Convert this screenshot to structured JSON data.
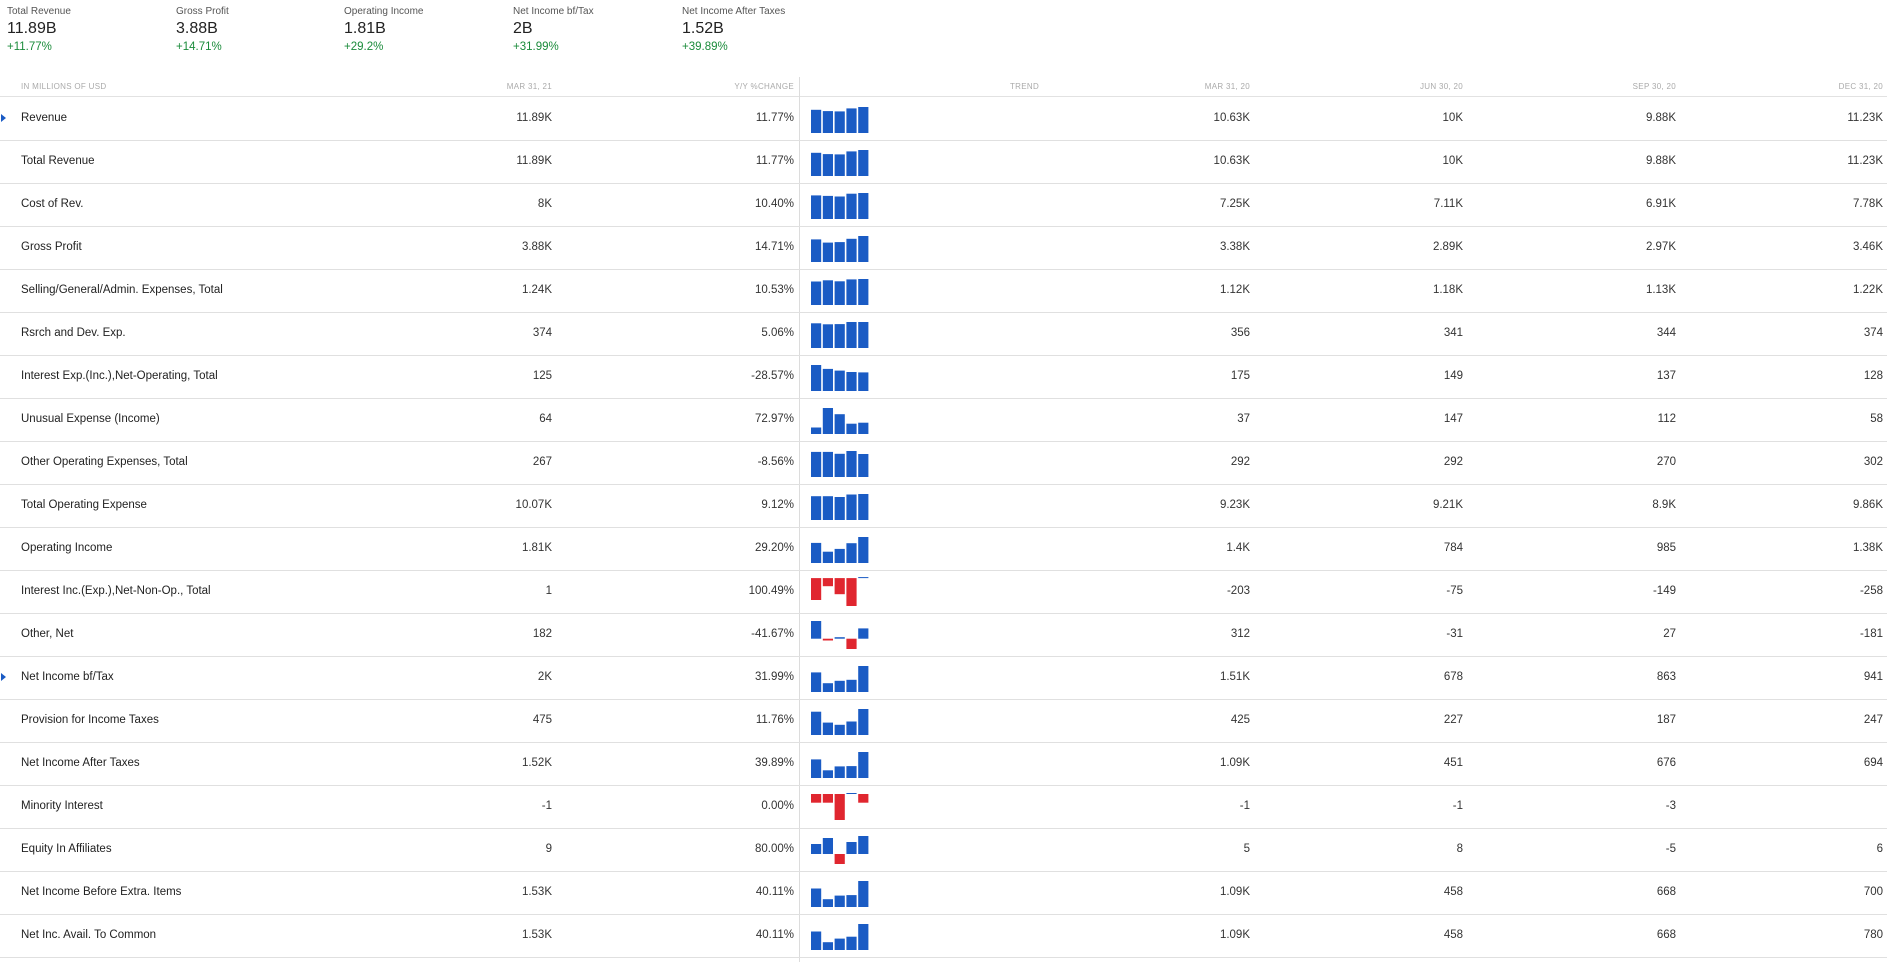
{
  "kpis": [
    {
      "label": "Total Revenue",
      "value": "11.89B",
      "change": "+11.77%"
    },
    {
      "label": "Gross Profit",
      "value": "3.88B",
      "change": "+14.71%"
    },
    {
      "label": "Operating Income",
      "value": "1.81B",
      "change": "+29.2%"
    },
    {
      "label": "Net Income bf/Tax",
      "value": "2B",
      "change": "+31.99%"
    },
    {
      "label": "Net Income After Taxes",
      "value": "1.52B",
      "change": "+39.89%"
    }
  ],
  "table": {
    "headers": {
      "units": "IN MILLIONS OF USD",
      "current": "MAR 31, 21",
      "yoy": "Y/Y %CHANGE",
      "trend": "TREND",
      "q1": "MAR 31, 20",
      "q2": "JUN 30, 20",
      "q3": "SEP 30, 20",
      "q4": "DEC 31, 20"
    },
    "colors": {
      "positive": "#1a8b3a",
      "negative": "#d2232a",
      "bar_up": "#1a5bc4",
      "bar_down": "#e0262f"
    },
    "rows": [
      {
        "name": "Revenue",
        "expandable": true,
        "current": "11.89K",
        "yoy": "11.77%",
        "yoy_sign": "pos",
        "q1": "10.63K",
        "q2": "10K",
        "q3": "9.88K",
        "q4": "11.23K",
        "trend": [
          10630,
          10000,
          9880,
          11230,
          11890
        ]
      },
      {
        "name": "Total Revenue",
        "expandable": false,
        "current": "11.89K",
        "yoy": "11.77%",
        "yoy_sign": "pos",
        "q1": "10.63K",
        "q2": "10K",
        "q3": "9.88K",
        "q4": "11.23K",
        "trend": [
          10630,
          10000,
          9880,
          11230,
          11890
        ]
      },
      {
        "name": "Cost of Rev.",
        "expandable": false,
        "current": "8K",
        "yoy": "10.40%",
        "yoy_sign": "pos",
        "q1": "7.25K",
        "q2": "7.11K",
        "q3": "6.91K",
        "q4": "7.78K",
        "trend": [
          7250,
          7110,
          6910,
          7780,
          8000
        ]
      },
      {
        "name": "Gross Profit",
        "expandable": false,
        "current": "3.88K",
        "yoy": "14.71%",
        "yoy_sign": "pos",
        "q1": "3.38K",
        "q2": "2.89K",
        "q3": "2.97K",
        "q4": "3.46K",
        "trend": [
          3380,
          2890,
          2970,
          3460,
          3880
        ]
      },
      {
        "name": "Selling/General/Admin. Expenses, Total",
        "expandable": false,
        "current": "1.24K",
        "yoy": "10.53%",
        "yoy_sign": "pos",
        "q1": "1.12K",
        "q2": "1.18K",
        "q3": "1.13K",
        "q4": "1.22K",
        "trend": [
          1120,
          1180,
          1130,
          1220,
          1240
        ]
      },
      {
        "name": "Rsrch and Dev. Exp.",
        "expandable": false,
        "current": "374",
        "yoy": "5.06%",
        "yoy_sign": "pos",
        "q1": "356",
        "q2": "341",
        "q3": "344",
        "q4": "374",
        "trend": [
          356,
          341,
          344,
          374,
          374
        ]
      },
      {
        "name": "Interest Exp.(Inc.),Net-Operating, Total",
        "expandable": false,
        "current": "125",
        "yoy": "-28.57%",
        "yoy_sign": "neg",
        "q1": "175",
        "q2": "149",
        "q3": "137",
        "q4": "128",
        "trend": [
          175,
          149,
          137,
          128,
          125
        ]
      },
      {
        "name": "Unusual Expense (Income)",
        "expandable": false,
        "current": "64",
        "yoy": "72.97%",
        "yoy_sign": "pos",
        "q1": "37",
        "q2": "147",
        "q3": "112",
        "q4": "58",
        "trend": [
          37,
          147,
          112,
          58,
          64
        ]
      },
      {
        "name": "Other Operating Expenses, Total",
        "expandable": false,
        "current": "267",
        "yoy": "-8.56%",
        "yoy_sign": "neg",
        "q1": "292",
        "q2": "292",
        "q3": "270",
        "q4": "302",
        "trend": [
          292,
          292,
          270,
          302,
          267
        ]
      },
      {
        "name": "Total Operating Expense",
        "expandable": false,
        "current": "10.07K",
        "yoy": "9.12%",
        "yoy_sign": "pos",
        "q1": "9.23K",
        "q2": "9.21K",
        "q3": "8.9K",
        "q4": "9.86K",
        "trend": [
          9230,
          9210,
          8900,
          9860,
          10070
        ]
      },
      {
        "name": "Operating Income",
        "expandable": false,
        "current": "1.81K",
        "yoy": "29.20%",
        "yoy_sign": "pos",
        "q1": "1.4K",
        "q2": "784",
        "q3": "985",
        "q4": "1.38K",
        "trend": [
          1400,
          784,
          985,
          1380,
          1810
        ]
      },
      {
        "name": "Interest Inc.(Exp.),Net-Non-Op., Total",
        "expandable": false,
        "current": "1",
        "yoy": "100.49%",
        "yoy_sign": "pos",
        "q1": "-203",
        "q2": "-75",
        "q3": "-149",
        "q4": "-258",
        "trend": [
          -203,
          -75,
          -149,
          -258,
          1
        ]
      },
      {
        "name": "Other, Net",
        "expandable": false,
        "current": "182",
        "yoy": "-41.67%",
        "yoy_sign": "neg",
        "q1": "312",
        "q2": "-31",
        "q3": "27",
        "q4": "-181",
        "trend": [
          312,
          -31,
          27,
          -181,
          182
        ]
      },
      {
        "name": "Net Income bf/Tax",
        "expandable": true,
        "current": "2K",
        "yoy": "31.99%",
        "yoy_sign": "pos",
        "q1": "1.51K",
        "q2": "678",
        "q3": "863",
        "q4": "941",
        "trend": [
          1510,
          678,
          863,
          941,
          2000
        ]
      },
      {
        "name": "Provision for Income Taxes",
        "expandable": false,
        "current": "475",
        "yoy": "11.76%",
        "yoy_sign": "pos",
        "q1": "425",
        "q2": "227",
        "q3": "187",
        "q4": "247",
        "trend": [
          425,
          227,
          187,
          247,
          475
        ]
      },
      {
        "name": "Net Income After Taxes",
        "expandable": false,
        "current": "1.52K",
        "yoy": "39.89%",
        "yoy_sign": "pos",
        "q1": "1.09K",
        "q2": "451",
        "q3": "676",
        "q4": "694",
        "trend": [
          1090,
          451,
          676,
          694,
          1520
        ]
      },
      {
        "name": "Minority Interest",
        "expandable": false,
        "current": "-1",
        "yoy": "0.00%",
        "yoy_sign": "none",
        "q1": "-1",
        "q2": "-1",
        "q3": "-3",
        "q4": "",
        "trend": [
          -1,
          -1,
          -3,
          0,
          -1
        ]
      },
      {
        "name": "Equity In Affiliates",
        "expandable": false,
        "current": "9",
        "yoy": "80.00%",
        "yoy_sign": "pos",
        "q1": "5",
        "q2": "8",
        "q3": "-5",
        "q4": "6",
        "trend": [
          5,
          8,
          -5,
          6,
          9
        ]
      },
      {
        "name": "Net Income Before Extra. Items",
        "expandable": false,
        "current": "1.53K",
        "yoy": "40.11%",
        "yoy_sign": "pos",
        "q1": "1.09K",
        "q2": "458",
        "q3": "668",
        "q4": "700",
        "trend": [
          1090,
          458,
          668,
          700,
          1530
        ]
      },
      {
        "name": "Net Inc. Avail. To Common",
        "expandable": false,
        "current": "1.53K",
        "yoy": "40.11%",
        "yoy_sign": "pos",
        "q1": "1.09K",
        "q2": "458",
        "q3": "668",
        "q4": "780",
        "trend": [
          1090,
          458,
          668,
          780,
          1530
        ]
      }
    ]
  }
}
